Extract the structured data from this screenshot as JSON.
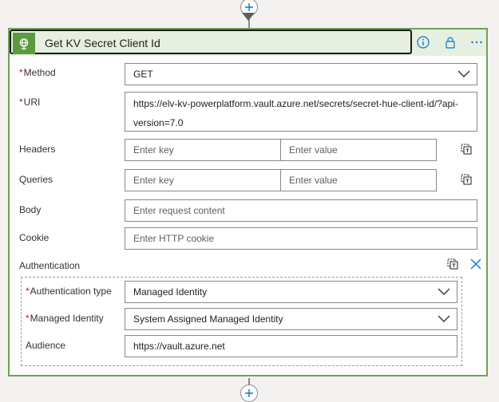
{
  "header": {
    "title": "Get KV Secret Client Id"
  },
  "fields": {
    "method": {
      "label": "Method",
      "required": true,
      "value": "GET"
    },
    "uri": {
      "label": "URI",
      "required": true,
      "value": "https://elv-kv-powerplatform.vault.azure.net/secrets/secret-hue-client-id/?api-version=7.0"
    },
    "headers": {
      "label": "Headers",
      "key_placeholder": "Enter key",
      "value_placeholder": "Enter value"
    },
    "queries": {
      "label": "Queries",
      "key_placeholder": "Enter key",
      "value_placeholder": "Enter value"
    },
    "body": {
      "label": "Body",
      "placeholder": "Enter request content"
    },
    "cookie": {
      "label": "Cookie",
      "placeholder": "Enter HTTP cookie"
    }
  },
  "authentication": {
    "label": "Authentication",
    "type": {
      "label": "Authentication type",
      "required": true,
      "value": "Managed Identity"
    },
    "identity": {
      "label": "Managed Identity",
      "required": true,
      "value": "System Assigned Managed Identity"
    },
    "audience": {
      "label": "Audience",
      "value": "https://vault.azure.net"
    }
  },
  "icons": [
    "globe-icon",
    "info-icon",
    "lock-icon",
    "more-icon",
    "chevron-down-icon",
    "switch-to-text-icon",
    "close-icon",
    "add-icon"
  ],
  "colors": {
    "accent": "#0078d4",
    "header_bg": "#e7f0e0",
    "brand_green": "#5b9a3f",
    "required": "#a4262c"
  }
}
